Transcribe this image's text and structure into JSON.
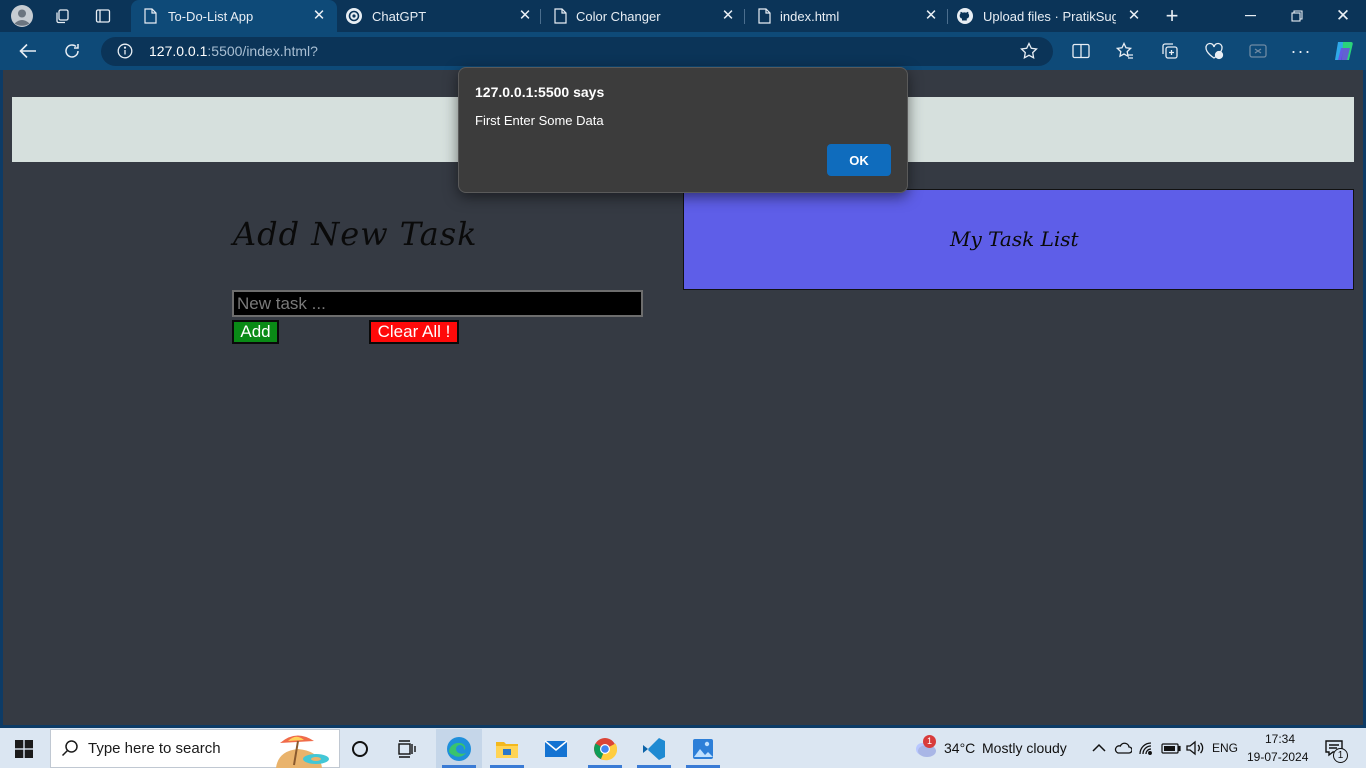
{
  "browser": {
    "tabs": [
      {
        "title": "To-Do-List App",
        "active": true
      },
      {
        "title": "ChatGPT",
        "active": false
      },
      {
        "title": "Color Changer",
        "active": false
      },
      {
        "title": "index.html",
        "active": false
      },
      {
        "title": "Upload files · PratikSugan",
        "active": false
      }
    ],
    "url_host": "127.0.0.1",
    "url_rest": ":5500/index.html?"
  },
  "page": {
    "add_task_title": "Add New Task",
    "input_placeholder": "New task ...",
    "add_button": "Add",
    "clear_button": "Clear All !",
    "task_list_title": "My Task List"
  },
  "alert": {
    "title": "127.0.0.1:5500 says",
    "message": "First Enter Some Data",
    "ok_button": "OK"
  },
  "taskbar": {
    "search_placeholder": "Type here to search",
    "weather_temp": "34°C",
    "weather_desc": "Mostly cloudy",
    "weather_badge": "1",
    "language": "ENG",
    "time": "17:34",
    "date": "19-07-2024",
    "notification_count": "1"
  },
  "colors": {
    "page_bg": "#353a43",
    "task_list_bg": "#5e5ee8",
    "add_button_bg": "#0a8a16",
    "clear_button_bg": "#ff0a0a",
    "ok_button_bg": "#0f6cbd"
  }
}
